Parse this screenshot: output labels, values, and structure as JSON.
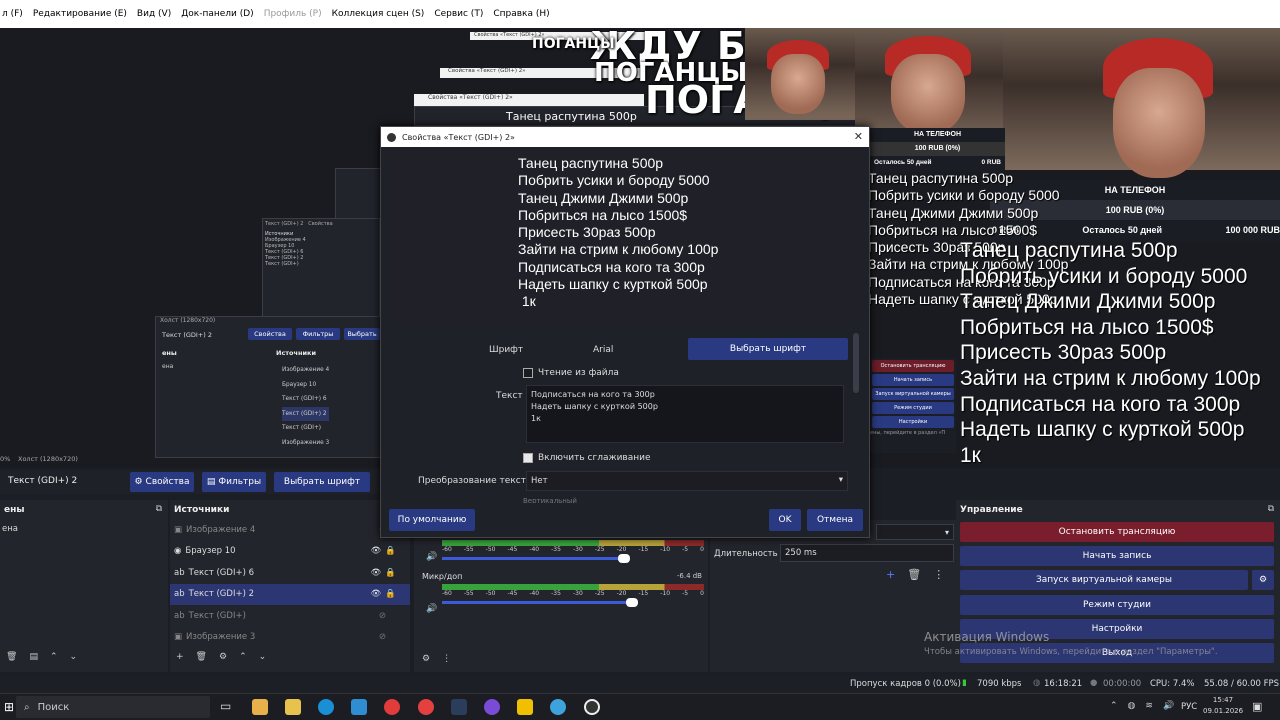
{
  "menu": {
    "items": [
      "л (F)",
      "Редактирование (E)",
      "Вид (V)",
      "Док-панели (D)",
      "Профиль (P)",
      "Коллекция сцен (S)",
      "Сервис (T)",
      "Справка (H)"
    ]
  },
  "preview": {
    "overlay_top": "ЖДУ БЕКЕНГ",
    "overlay_small": "ПОГАНЦЫ",
    "overlay_mid": "ПОГАНЦЫ",
    "overlay_bottom": "ПОГАНЦЫ",
    "phone_label": "НА ТЕЛЕФОН",
    "phone_amount": "100 RUB (0%)",
    "phone_left": "Осталось 50 дней",
    "phone_total": "100 000 RUB",
    "phone_zero": "0 RUB",
    "canvas_label": "Холст (1280x720)",
    "canvas_pct": "0%",
    "mini_source": "Текст (GDI+) 2",
    "mini_props": "Свойства",
    "mini_filters": "Фильтры",
    "mini_choose": "Выбрать",
    "mini_sources_header": "Источники",
    "mini_scenes_header": "ены",
    "mini_scene_item": "ена",
    "mini_sources": [
      "Изображение 4",
      "Браузер 10",
      "Текст (GDI+) 6",
      "Текст (GDI+) 2",
      "Текст (GDI+)",
      "Изображение 3"
    ],
    "ctrl_buttons_mini": [
      "Остановить трансляцию",
      "Начать запись",
      "Запуск виртуальной камеры",
      "Режим студии",
      "Настройки"
    ],
    "mini_footer": "ены, перейдите в раздел «П",
    "right_lines": [
      "Танец распутина 500р",
      "Побрить усики и бороду 5000",
      "Танец Джими Джими 500р",
      "Побриться на лысо 1500$",
      "Присесть 30раз 500р",
      "Зайти на стрим к любому 100р",
      "Подписаться на кого та 300р",
      "Надеть шапку с курткой 500р",
      " 1к"
    ],
    "mid_lines": [
      "Танец распутина 500р",
      "Побрить усики и бороду 5000",
      "Танец Джими Джими 500р",
      "Побриться на лысо 1500$",
      "Присесть 30раз 500р",
      "Зайти на стрим к любому 100р",
      "Подписаться на кого та 300р",
      "Надеть шапку с курткой 500р"
    ],
    "titles_small": [
      "Свойства «Текст (GDI+) 2»",
      "Свойства «Текст (GDI+) 2»",
      "Свойства «Текст (GDI+) 2»"
    ]
  },
  "dialog": {
    "title": "Свойства «Текст (GDI+) 2»",
    "preview_text": "Танец распутина 500р\nПобрить усики и бороду 5000\nТанец Джими Джими 500р\nПобриться на лысо 1500$\nПрисесть 30раз 500р\nЗайти на стрим к любому 100р\nПодписаться на кого та 300р\nНадеть шапку с курткой 500р\n 1к",
    "font_label": "Шрифт",
    "font_value": "Arial",
    "choose_font": "Выбрать шрифт",
    "read_file": "Чтение из файла",
    "text_label": "Текст",
    "text_lines": [
      "Подписаться на кого та 300р",
      "Надеть шапку с курткой 500р",
      " 1к"
    ],
    "antialias": "Включить сглаживание",
    "transform_label": "Преобразование текста",
    "transform_value": "Нет",
    "partial": "Вертикальный",
    "defaults": "По умолчанию",
    "ok": "OK",
    "cancel": "Отмена"
  },
  "toolbar": {
    "source_name": "Текст (GDI+) 2",
    "properties": "Свойства",
    "filters": "Фильтры",
    "choose_font": "Выбрать шрифт"
  },
  "scenes": {
    "header": "ены",
    "item": "ена"
  },
  "sources": {
    "header": "Источники",
    "items": [
      {
        "label": "Изображение 4",
        "dim": true
      },
      {
        "label": "Браузер 10",
        "dim": false
      },
      {
        "label": "Текст (GDI+) 6",
        "dim": false
      },
      {
        "label": "Текст (GDI+) 2",
        "dim": false
      },
      {
        "label": "Текст (GDI+)",
        "dim": true
      },
      {
        "label": "Изображение 3",
        "dim": true
      }
    ]
  },
  "mixer": {
    "mic_label": "Микр/доп",
    "mic_db": "-6.4 dB",
    "scale": [
      "-60",
      "-55",
      "-50",
      "-45",
      "-40",
      "-35",
      "-30",
      "-25",
      "-20",
      "-15",
      "-10",
      "-5",
      "0"
    ]
  },
  "transition": {
    "duration_label": "Длительность",
    "duration_value": "250 ms"
  },
  "controls": {
    "header": "Управление",
    "buttons": [
      "Остановить трансляцию",
      "Начать запись",
      "Запуск виртуальной камеры",
      "Режим студии",
      "Настройки",
      "Выход"
    ],
    "activate_title": "Активация Windows",
    "activate_sub": "Чтобы активировать Windows, перейдите в раздел \"Параметры\"."
  },
  "status": {
    "dropped": "Пропуск кадров 0 (0.0%)",
    "bitrate": "7090 kbps",
    "live_time": "16:18:21",
    "rec_time": "00:00:00",
    "cpu": "CPU: 7.4%",
    "fps": "55.08 / 60.00 FPS"
  },
  "taskbar": {
    "search": "Поиск",
    "lang": "РУС",
    "time": "15:47",
    "date": "09.01.2026"
  },
  "colors": {
    "accent": "#2b3673",
    "stop": "#7a1e2e"
  }
}
